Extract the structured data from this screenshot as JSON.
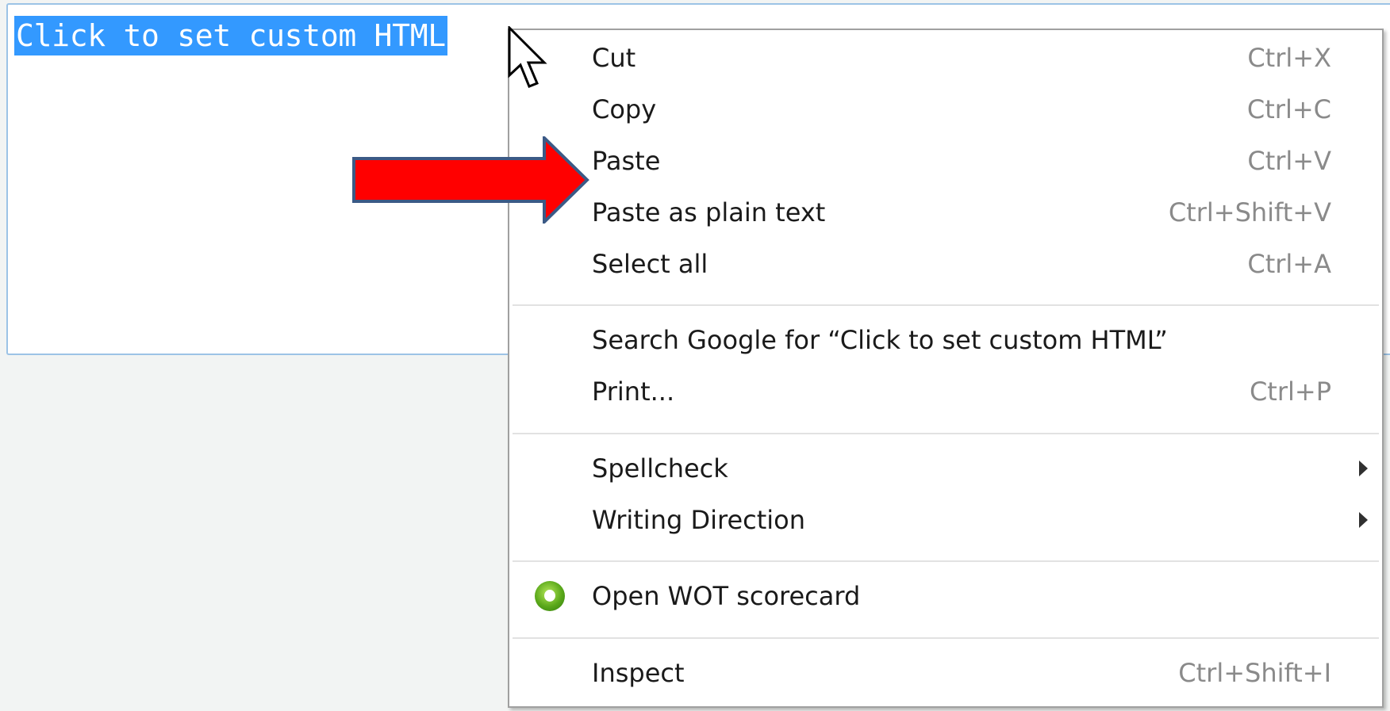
{
  "editor": {
    "selected_text": "Click to set custom HTML"
  },
  "context_menu": {
    "groups": [
      [
        {
          "label": "Cut",
          "shortcut": "Ctrl+X"
        },
        {
          "label": "Copy",
          "shortcut": "Ctrl+C"
        },
        {
          "label": "Paste",
          "shortcut": "Ctrl+V"
        },
        {
          "label": "Paste as plain text",
          "shortcut": "Ctrl+Shift+V"
        },
        {
          "label": "Select all",
          "shortcut": "Ctrl+A"
        }
      ],
      [
        {
          "label": "Search Google for “Click to set custom HTML”",
          "shortcut": ""
        },
        {
          "label": "Print...",
          "shortcut": "Ctrl+P"
        }
      ],
      [
        {
          "label": "Spellcheck",
          "submenu": true
        },
        {
          "label": "Writing Direction",
          "submenu": true
        }
      ],
      [
        {
          "label": "Open WOT scorecard",
          "icon": "wot-icon"
        }
      ],
      [
        {
          "label": "Inspect",
          "shortcut": "Ctrl+Shift+I"
        }
      ]
    ]
  },
  "annotation": {
    "arrow_color": "#ff0000",
    "arrow_outline": "#3b5a86",
    "points_to": "Paste"
  },
  "colors": {
    "selection": "#3399ff",
    "editor_border": "#9cc3e6",
    "shortcut_text": "#8a8a8a"
  }
}
